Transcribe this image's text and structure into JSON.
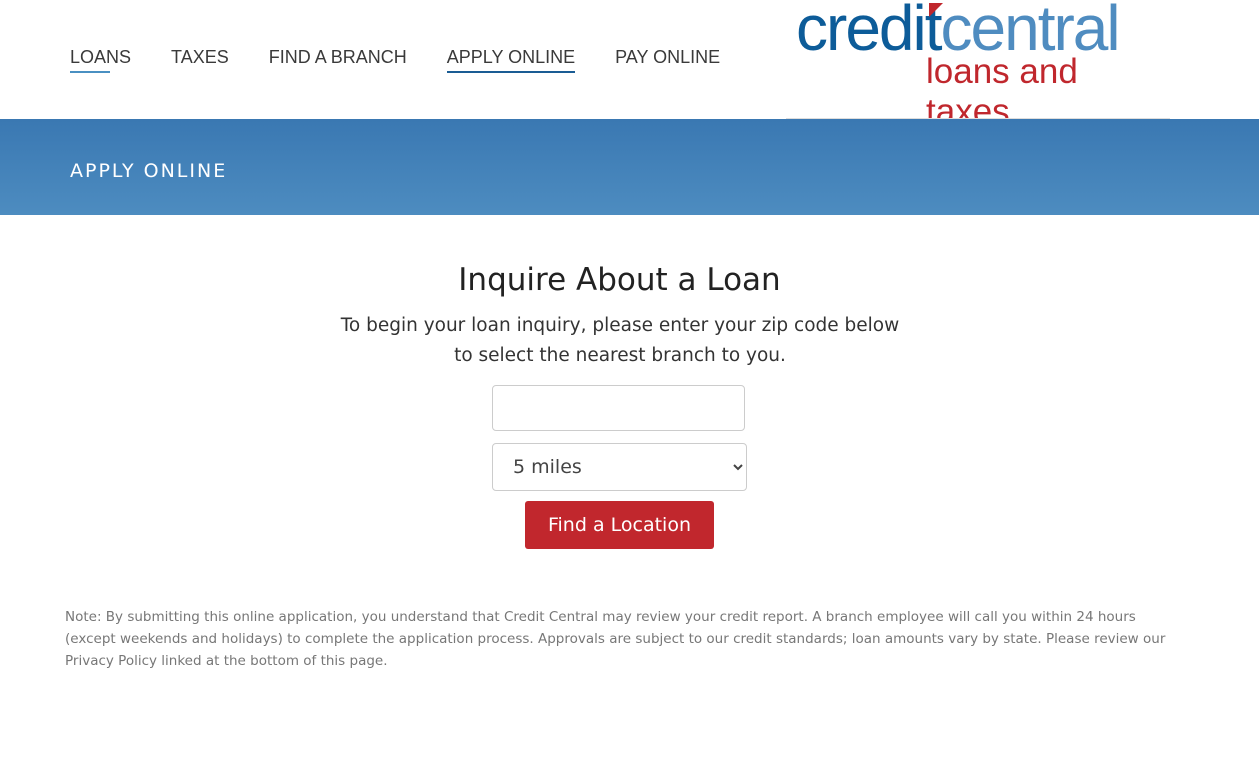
{
  "nav": {
    "items": [
      {
        "label": "LOANS"
      },
      {
        "label": "TAXES"
      },
      {
        "label": "FIND A BRANCH"
      },
      {
        "label": "APPLY ONLINE"
      },
      {
        "label": "PAY ONLINE"
      }
    ]
  },
  "logo": {
    "part1": "credit",
    "part2": "central",
    "tagline": "loans and taxes"
  },
  "banner": {
    "title": "APPLY ONLINE"
  },
  "main": {
    "heading": "Inquire About a Loan",
    "subtitle": "To begin your loan inquiry, please enter your zip code below to select the nearest branch to you.",
    "zip_value": "",
    "radius_selected": "5 miles",
    "button": "Find a Location"
  },
  "note": "Note: By submitting this online application, you understand that Credit Central may review your credit report. A branch employee will call you within 24 hours (except weekends and holidays) to complete the application process. Approvals are subject to our credit standards; loan amounts vary by state. Please review our Privacy Policy linked at the bottom of this page.",
  "colors": {
    "brand_blue": "#0d5c99",
    "banner": "#3a78b2",
    "accent_red": "#c1272d"
  }
}
